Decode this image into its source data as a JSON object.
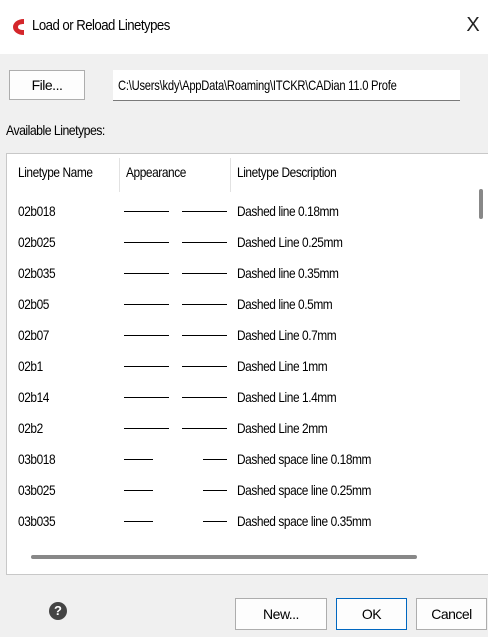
{
  "window": {
    "title": "Load or Reload Linetypes",
    "close_glyph": "X",
    "app_icon": "cadian-icon"
  },
  "file_button": {
    "label": "File..."
  },
  "path_field": {
    "value": "C:\\Users\\kdy\\AppData\\Roaming\\ITCKR\\CADian 11.0 Profe"
  },
  "available_label": "Available Linetypes:",
  "list": {
    "columns": [
      "Linetype Name",
      "Appearance",
      "Linetype Description"
    ],
    "rows": [
      {
        "name": "02b018",
        "description": "Dashed line 0.18mm"
      },
      {
        "name": "02b025",
        "description": "Dashed Line 0.25mm"
      },
      {
        "name": "02b035",
        "description": "Dashed line 0.35mm"
      },
      {
        "name": "02b05",
        "description": "Dashed line 0.5mm"
      },
      {
        "name": "02b07",
        "description": "Dashed Line 0.7mm"
      },
      {
        "name": "02b1",
        "description": "Dashed Line 1mm"
      },
      {
        "name": "02b14",
        "description": "Dashed Line 1.4mm"
      },
      {
        "name": "02b2",
        "description": "Dashed Line 2mm"
      },
      {
        "name": "03b018",
        "description": "Dashed space line 0.18mm"
      },
      {
        "name": "03b025",
        "description": "Dashed space line 0.25mm"
      },
      {
        "name": "03b035",
        "description": "Dashed space line 0.35mm"
      }
    ]
  },
  "buttons": {
    "new": "New...",
    "ok": "OK",
    "cancel": "Cancel"
  },
  "help_icon": {
    "glyph": "?",
    "name": "help-icon"
  },
  "colors": {
    "app_icon": "#d4262b",
    "ok_border": "#0067c0"
  }
}
